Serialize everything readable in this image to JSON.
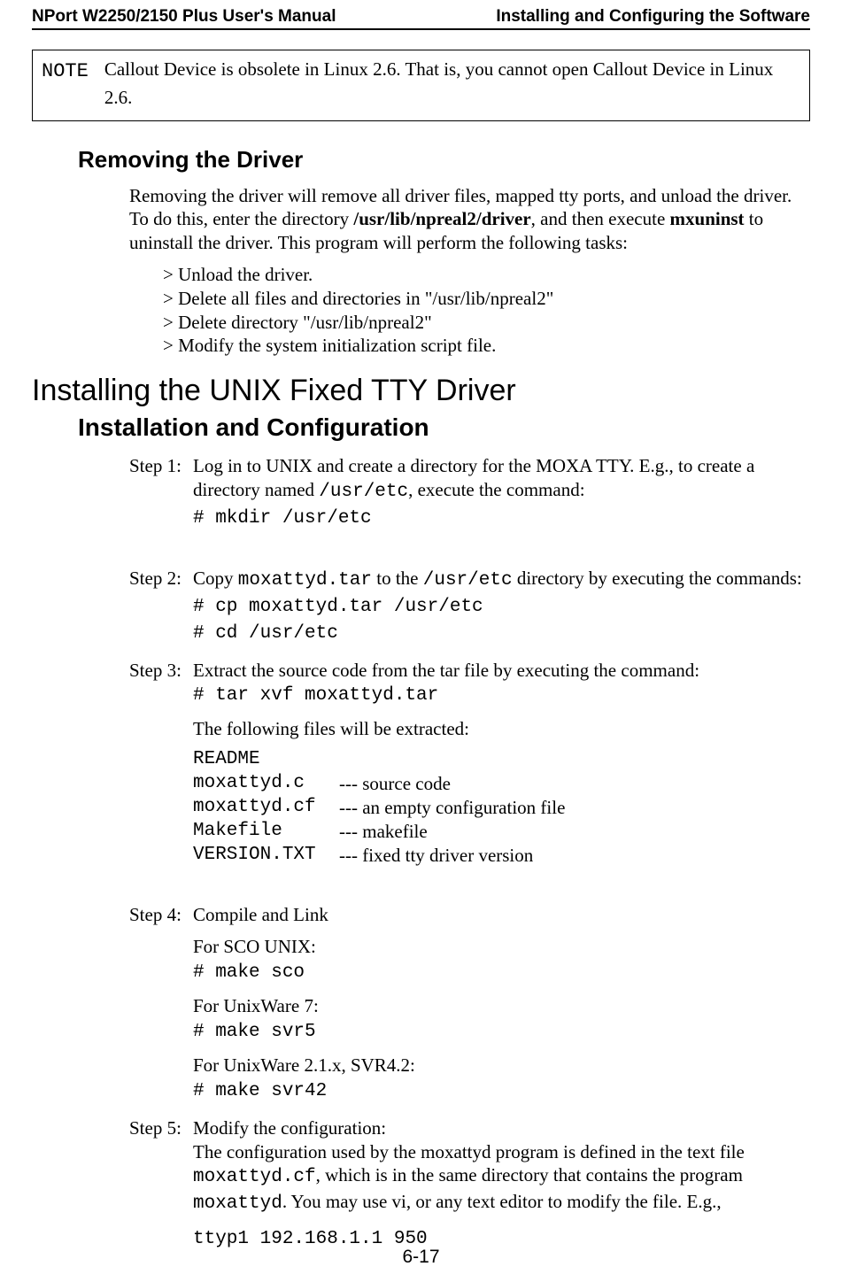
{
  "header": {
    "left": "NPort W2250/2150 Plus User's Manual",
    "right": "Installing and Configuring the Software"
  },
  "note": {
    "label": "NOTE",
    "text": "Callout Device is obsolete in Linux 2.6. That is, you cannot open Callout Device in Linux 2.6."
  },
  "removing": {
    "heading": "Removing the Driver",
    "para_parts": {
      "p1": "Removing the driver will remove all driver files, mapped tty ports, and unload the driver. To do this, enter the directory ",
      "bold1": "/usr/lib/npreal2/driver",
      "p2": ", and then execute ",
      "bold2": "mxuninst",
      "p3": " to uninstall the driver. This program will perform the following tasks:"
    },
    "bullets": [
      "> Unload the driver.",
      "> Delete all files and directories in \"/usr/lib/npreal2\"",
      "> Delete directory \"/usr/lib/npreal2\"",
      "> Modify the system initialization script file."
    ]
  },
  "unix": {
    "section_heading": "Installing the UNIX Fixed TTY Driver",
    "sub_heading": "Installation and Configuration",
    "steps": {
      "s1": {
        "label": "Step 1:",
        "t1": "Log in to UNIX and create a directory for the MOXA TTY. E.g., to create a directory named ",
        "m1": "/usr/etc",
        "t2": ", execute the command:",
        "cmd": "# mkdir /usr/etc"
      },
      "s2": {
        "label": "Step 2:",
        "t1": "Copy ",
        "m1": "moxattyd.tar",
        "t2": " to the  ",
        "m2": "/usr/etc",
        "t3": " directory by executing the commands:",
        "cmd1": "# cp moxattyd.tar /usr/etc",
        "cmd2": "# cd /usr/etc"
      },
      "s3": {
        "label": "Step 3:",
        "t1": "Extract the source code from the tar file by executing the command:",
        "cmd": "# tar xvf moxattyd.tar",
        "t2": "The following files will be extracted:",
        "files": [
          {
            "name": "README",
            "desc": ""
          },
          {
            "name": "moxattyd.c",
            "desc": "--- source code"
          },
          {
            "name": "moxattyd.cf",
            "desc": "--- an empty configuration file"
          },
          {
            "name": "Makefile",
            "desc": "--- makefile"
          },
          {
            "name": "VERSION.TXT",
            "desc": "--- fixed tty driver version"
          }
        ]
      },
      "s4": {
        "label": "Step 4:",
        "title": "Compile and Link",
        "sco_label": "For SCO UNIX:",
        "sco_cmd": "# make sco",
        "uw7_label": "For UnixWare 7:",
        "uw7_cmd": "# make svr5",
        "uw21_label": "For UnixWare 2.1.x, SVR4.2:",
        "uw21_cmd": "# make svr42"
      },
      "s5": {
        "label": "Step 5:",
        "t1": "Modify the configuration:",
        "t2a": "The configuration used by the moxattyd program is defined in the text file ",
        "m1": "moxattyd.cf",
        "t2b": ", which is in the same directory that contains the program ",
        "m2": "moxattyd",
        "t2c": ". You may use vi, or any text editor to modify the file. E.g.,",
        "cmd": "ttyp1 192.168.1.1 950"
      }
    }
  },
  "page_number": "6-17"
}
